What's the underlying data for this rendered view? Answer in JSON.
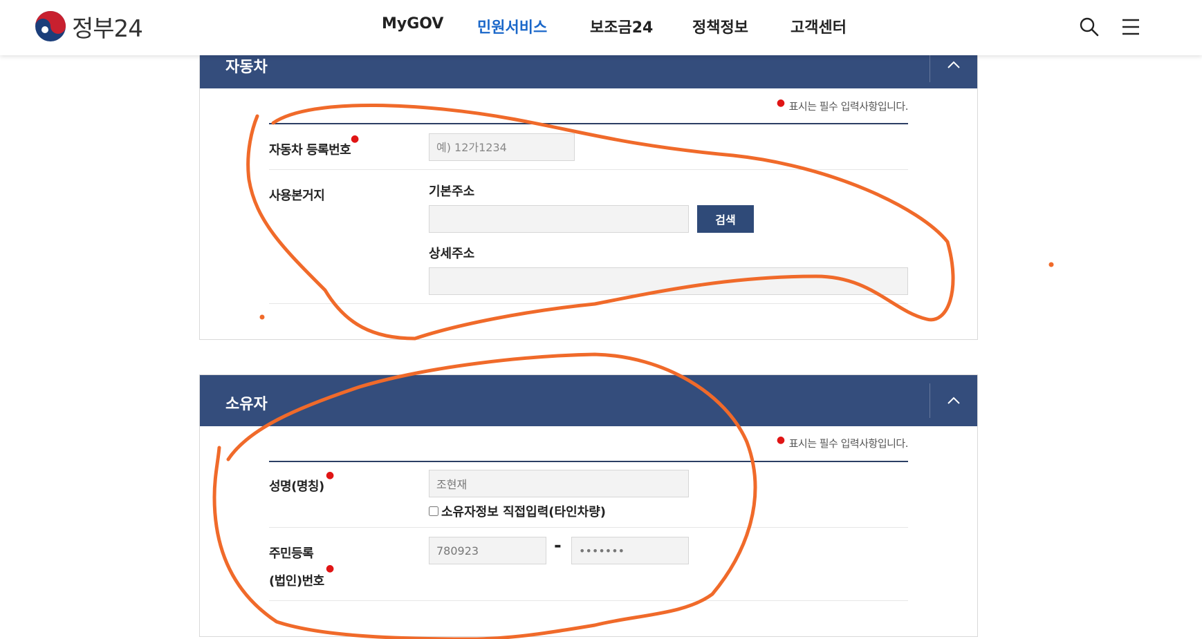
{
  "header": {
    "logo_text": "정부24",
    "nav": [
      "MyGOV",
      "민원서비스",
      "보조금24",
      "정책정보",
      "고객센터"
    ],
    "active_nav": "민원서비스",
    "icons": [
      "search-icon",
      "menu-icon"
    ],
    "accent_color": "#1a67c9"
  },
  "vehicle_section": {
    "title": "자동차",
    "required_note": "표시는 필수 입력사항입니다.",
    "reg_number_label": "자동차 등록번호",
    "reg_number_placeholder": "예) 12가1234",
    "address_label": "사용본거지",
    "basic_address_label": "기본주소",
    "search_button": "검색",
    "detail_address_label": "상세주소"
  },
  "owner_section": {
    "title": "소유자",
    "required_note": "표시는 필수 입력사항입니다.",
    "name_label": "성명(명칭)",
    "name_value": "조현재",
    "direct_input_label": "소유자정보 직접입력(타인차량)",
    "resident_label_line1": "주민등록",
    "resident_label_line2": "(법인)번호",
    "resident_front": "780923",
    "resident_back": "•••••••",
    "separator": "-"
  },
  "colors": {
    "panel_header": "#344d7c",
    "button": "#2f4a78",
    "required_dot": "#e01515",
    "annotation": "#f06a2a"
  }
}
